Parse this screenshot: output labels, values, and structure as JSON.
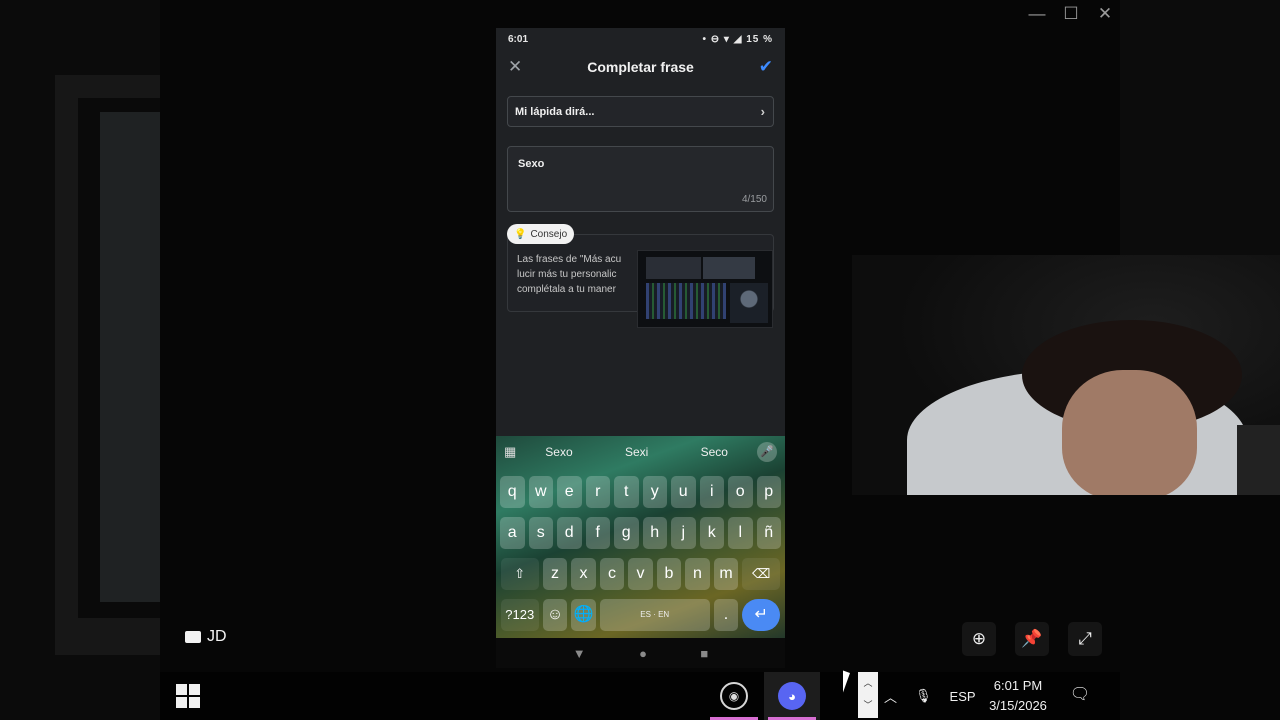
{
  "phone": {
    "status_time": "6:01",
    "status_icons": "• ⊖ ▾ ◢ 15 %",
    "title": "Completar frase",
    "prompt_label": "Mi lápida dirá...",
    "answer_text": "Sexo",
    "char_count": "4/150",
    "tip_badge": "Consejo",
    "tip_lines": [
      "Las frases de \"Más acu",
      "lucir más tu personalic",
      "complétala a tu maner"
    ]
  },
  "keyboard": {
    "suggestions": [
      "Sexo",
      "Sexi",
      "Seco"
    ],
    "row1": [
      "q",
      "w",
      "e",
      "r",
      "t",
      "y",
      "u",
      "i",
      "o",
      "p"
    ],
    "row2": [
      "a",
      "s",
      "d",
      "f",
      "g",
      "h",
      "j",
      "k",
      "l",
      "ñ"
    ],
    "row3": [
      "z",
      "x",
      "c",
      "v",
      "b",
      "n",
      "m"
    ],
    "symbols_key": "?123",
    "space_label": "ES · EN",
    "period_key": "."
  },
  "overlay": {
    "source_label": "JD"
  },
  "taskbar": {
    "language": "ESP",
    "time": "6:01 PM",
    "date": "3/15/2026"
  },
  "icons": {
    "shift": "shift-icon",
    "backspace": "backspace-icon",
    "globe": "globe-icon",
    "enter": "enter-icon"
  },
  "colors": {
    "accent_blue": "#3d8bff",
    "discord": "#5865f2",
    "taskbar_underline": "#d86fd3"
  }
}
